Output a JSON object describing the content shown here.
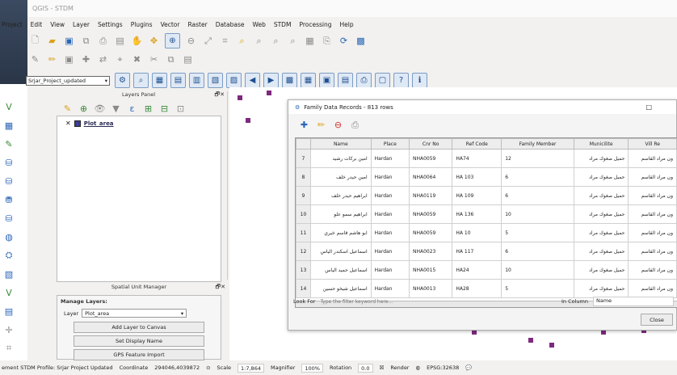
{
  "window": {
    "title": "QGIS - STDM"
  },
  "menu": [
    "Project",
    "Edit",
    "View",
    "Layer",
    "Settings",
    "Plugins",
    "Vector",
    "Raster",
    "Database",
    "Web",
    "STDM",
    "Processing",
    "Help"
  ],
  "project_select": "Srjar_Project_updated",
  "layers_panel": {
    "title": "Layers Panel",
    "close": "🗗✕",
    "layers": [
      {
        "name": "Plot_area",
        "checked": true,
        "color": "#3b3f98"
      }
    ]
  },
  "spatial_unit_manager": {
    "title": "Spatial Unit Manager",
    "close": "🗗✕",
    "group_title": "Manage Layers:",
    "layer_label": "Layer",
    "layer_value": "Plot_area",
    "buttons": [
      "Add Layer to Canvas",
      "Set Display Name",
      "GPS Feature Import"
    ]
  },
  "dialog": {
    "title": "Family Data Records - 813 rows",
    "window_ctrl": "□",
    "columns": [
      "Name",
      "Place",
      "Cnr No",
      "Ref Code",
      "Family Member",
      "Municilite",
      "Vill Re"
    ],
    "rows": [
      {
        "n": "7",
        "name": "امين بركات رشيد",
        "place": "Hardan",
        "cnr": "NHA0059",
        "ref": "HA74",
        "fam": "12",
        "mun": "حميل صغوك مراد",
        "vil": "ون مراد القاسم"
      },
      {
        "n": "8",
        "name": "امين حيدر خلف",
        "place": "Hardan",
        "cnr": "NHA0064",
        "ref": "HA 103",
        "fam": "6",
        "mun": "حميل صغوك مراد",
        "vil": "ون مراد القاسم"
      },
      {
        "n": "9",
        "name": "ابراهيم حيدر خلف",
        "place": "Hardan",
        "cnr": "NHA0119",
        "ref": "HA 109",
        "fam": "6",
        "mun": "حميل صغوك مراد",
        "vil": "ون مراد القاسم"
      },
      {
        "n": "10",
        "name": "ابراهيم سمو علو",
        "place": "Hardan",
        "cnr": "NHA0059",
        "ref": "HA 136",
        "fam": "10",
        "mun": "حميل صغوك مراد",
        "vil": "ون مراد القاسم"
      },
      {
        "n": "11",
        "name": "ابو هاشم قاسم خيري",
        "place": "Hardan",
        "cnr": "NHA0059",
        "ref": "HA 10",
        "fam": "5",
        "mun": "حميل صغوك مراد",
        "vil": "ون مراد القاسم"
      },
      {
        "n": "12",
        "name": "اسماعيل اسكندر الياس",
        "place": "Hardan",
        "cnr": "NHA0023",
        "ref": "HA 117",
        "fam": "6",
        "mun": "حميل صغوك مراد",
        "vil": "ون مراد القاسم"
      },
      {
        "n": "13",
        "name": "اسماعيل حميد الياس",
        "place": "Hardan",
        "cnr": "NHA0015",
        "ref": "HA24",
        "fam": "10",
        "mun": "حميل صغوك مراد",
        "vil": "ون مراد القاسم"
      },
      {
        "n": "14",
        "name": "اسماعيل شيخو حسين",
        "place": "Hardan",
        "cnr": "NHA0013",
        "ref": "HA28",
        "fam": "5",
        "mun": "حميل صغوك مراد",
        "vil": "ون مراد القاسم"
      }
    ],
    "look_for_label": "Look For",
    "look_for_placeholder": "Type the filter keyword here...",
    "in_column_label": "In Column",
    "in_column_value": "Name",
    "close_label": "Close"
  },
  "status": {
    "project": "ement STDM Profile: Srjar Project Updated",
    "coord_label": "Coordinate",
    "coord_value": "294046,4039872",
    "scale_label": "Scale",
    "scale_value": "1:7,864",
    "magnifier_label": "Magnifier",
    "magnifier_value": "100%",
    "rotation_label": "Rotation",
    "rotation_value": "0.0",
    "render_label": "Render",
    "epsg": "EPSG:32638"
  }
}
